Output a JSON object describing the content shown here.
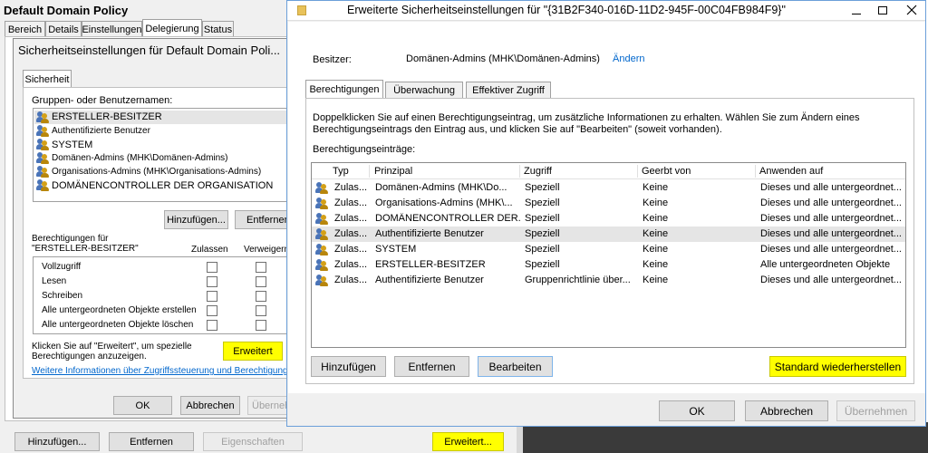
{
  "back": {
    "title": "Default Domain Policy",
    "tabs": [
      "Bereich",
      "Details",
      "Einstellungen",
      "Delegierung",
      "Status"
    ],
    "bottom_buttons": [
      "Hinzufügen...",
      "Entfernen",
      "Eigenschaften",
      "Erweitert..."
    ]
  },
  "mid": {
    "title": "Sicherheitseinstellungen für Default Domain Poli...",
    "tab": "Sicherheit",
    "groups_label": "Gruppen- oder Benutzernamen:",
    "groups": [
      "ERSTELLER-BESITZER",
      "Authentifizierte Benutzer",
      "SYSTEM",
      "Domänen-Admins (MHK\\Domänen-Admins)",
      "Organisations-Admins (MHK\\Organisations-Admins)",
      "DOMÄNENCONTROLLER DER ORGANISATION"
    ],
    "add_button": "Hinzufügen...",
    "remove_button": "Entfernen",
    "perm_label_1": "Berechtigungen für",
    "perm_label_2": "\"ERSTELLER-BESITZER\"",
    "col_allow": "Zulassen",
    "col_deny": "Verweigern",
    "permissions": [
      "Vollzugriff",
      "Lesen",
      "Schreiben",
      "Alle untergeordneten Objekte erstellen",
      "Alle untergeordneten Objekte löschen"
    ],
    "advanced_hint_1": "Klicken Sie auf \"Erweitert\", um spezielle",
    "advanced_hint_2": "Berechtigungen anzuzeigen.",
    "advanced_button": "Erweitert",
    "link": "Weitere Informationen über Zugriffssteuerung und Berechtigungen",
    "ok": "OK",
    "cancel": "Abbrechen",
    "apply": "Übernehmen"
  },
  "front": {
    "title": "Erweiterte Sicherheitseinstellungen für \"{31B2F340-016D-11D2-945F-00C04FB984F9}\"",
    "owner_label": "Besitzer:",
    "owner_value": "Domänen-Admins (MHK\\Domänen-Admins)",
    "owner_change": "Ändern",
    "tabs": [
      "Berechtigungen",
      "Überwachung",
      "Effektiver Zugriff"
    ],
    "info_1": "Doppelklicken Sie auf einen Berechtigungseintrag, um zusätzliche Informationen zu erhalten. Wählen Sie zum Ändern eines",
    "info_2": "Berechtigungseintrags den Eintrag aus, und klicken Sie auf \"Bearbeiten\" (soweit vorhanden).",
    "entries_label": "Berechtigungseinträge:",
    "columns": [
      "Typ",
      "Prinzipal",
      "Zugriff",
      "Geerbt von",
      "Anwenden auf"
    ],
    "rows": [
      [
        "Zulas...",
        "Domänen-Admins (MHK\\Do...",
        "Speziell",
        "Keine",
        "Dieses und alle untergeordnet..."
      ],
      [
        "Zulas...",
        "Organisations-Admins (MHK\\...",
        "Speziell",
        "Keine",
        "Dieses und alle untergeordnet..."
      ],
      [
        "Zulas...",
        "DOMÄNENCONTROLLER DER...",
        "Speziell",
        "Keine",
        "Dieses und alle untergeordnet..."
      ],
      [
        "Zulas...",
        "Authentifizierte Benutzer",
        "Speziell",
        "Keine",
        "Dieses und alle untergeordnet..."
      ],
      [
        "Zulas...",
        "SYSTEM",
        "Speziell",
        "Keine",
        "Dieses und alle untergeordnet..."
      ],
      [
        "Zulas...",
        "ERSTELLER-BESITZER",
        "Speziell",
        "Keine",
        "Alle untergeordneten Objekte"
      ],
      [
        "Zulas...",
        "Authentifizierte Benutzer",
        "Gruppenrichtlinie über...",
        "Keine",
        "Dieses und alle untergeordnet..."
      ]
    ],
    "add_button": "Hinzufügen",
    "remove_button": "Entfernen",
    "edit_button": "Bearbeiten",
    "restore_button": "Standard wiederherstellen",
    "ok": "OK",
    "cancel": "Abbrechen",
    "apply": "Übernehmen"
  }
}
